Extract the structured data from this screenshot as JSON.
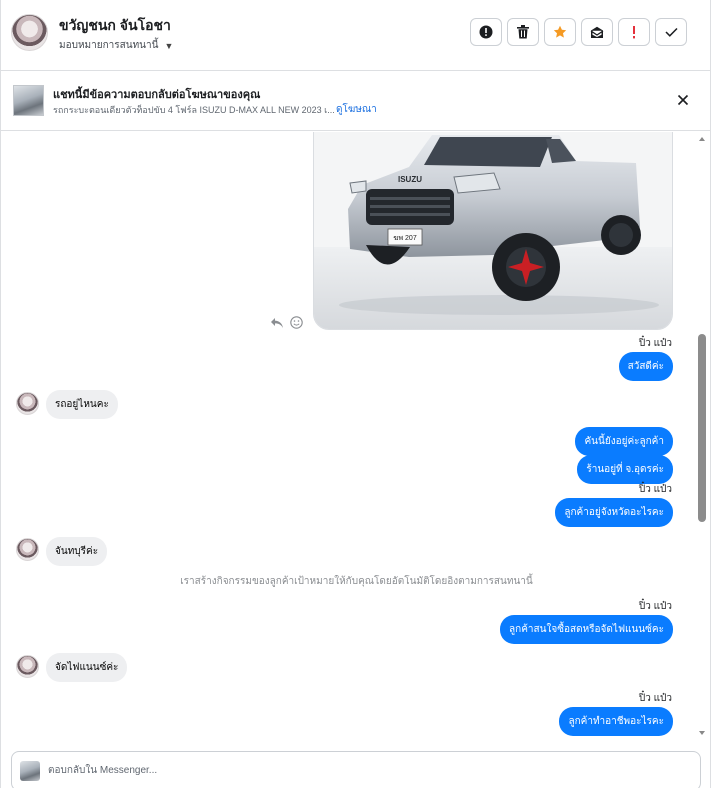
{
  "header": {
    "contact_name": "ขวัญชนก จันโอชา",
    "assign_label": "มอบหมายการสนทนานี้",
    "actions": [
      "alert-icon",
      "trash-icon",
      "star-icon",
      "mark-unread-icon",
      "important-icon",
      "done-check-icon"
    ],
    "star_color": "#f59a23",
    "important_color": "#e4313c"
  },
  "ad_banner": {
    "title": "แชทนี้มีข้อความตอบกลับต่อโฆษณาของคุณ",
    "subtitle": "รถกระบะตอนเดียวตัวท็อปขับ 4 โฟร์ล ISUZU D-MAX ALL NEW 2023 เ...",
    "link": "ดูโฆษณา"
  },
  "media": {
    "vehicle_brand": "ISUZU",
    "plate": "ฆพ 207"
  },
  "messages": [
    {
      "type": "sender",
      "text": "ปิ๋ว แป๋ว"
    },
    {
      "type": "out",
      "text": "สวัสดีค่ะ"
    },
    {
      "type": "in",
      "text": "รถอยู่ไหนคะ"
    },
    {
      "type": "out",
      "text": "คันนี้ยังอยู่ค่ะลูกค้า"
    },
    {
      "type": "out",
      "text": "ร้านอยู่ที่ จ.อุดรค่ะ"
    },
    {
      "type": "sender",
      "text": "ปิ๋ว แป๋ว"
    },
    {
      "type": "out",
      "text": "ลูกค้าอยู่จังหวัดอะไรคะ"
    },
    {
      "type": "in",
      "text": "จันทบุรีค่ะ"
    },
    {
      "type": "system",
      "text": "เราสร้างกิจกรรมของลูกค้าเป้าหมายให้กับคุณโดยอัตโนมัติโดยอิงตามการสนทนานี้"
    },
    {
      "type": "sender",
      "text": "ปิ๋ว แป๋ว"
    },
    {
      "type": "out",
      "text": "ลูกค้าสนใจซื้อสดหรือจัดไฟแนนซ์คะ"
    },
    {
      "type": "in",
      "text": "จัดไฟแนนซ์ค่ะ"
    },
    {
      "type": "sender",
      "text": "ปิ๋ว แป๋ว"
    },
    {
      "type": "out",
      "text": "ลูกค้าทำอาชีพอะไรคะ"
    }
  ],
  "composer": {
    "placeholder": "ตอบกลับใน Messenger..."
  },
  "colors": {
    "outgoing_bubble": "#0a7cff",
    "incoming_bubble": "#eeeff1",
    "link": "#1a6fe0"
  }
}
